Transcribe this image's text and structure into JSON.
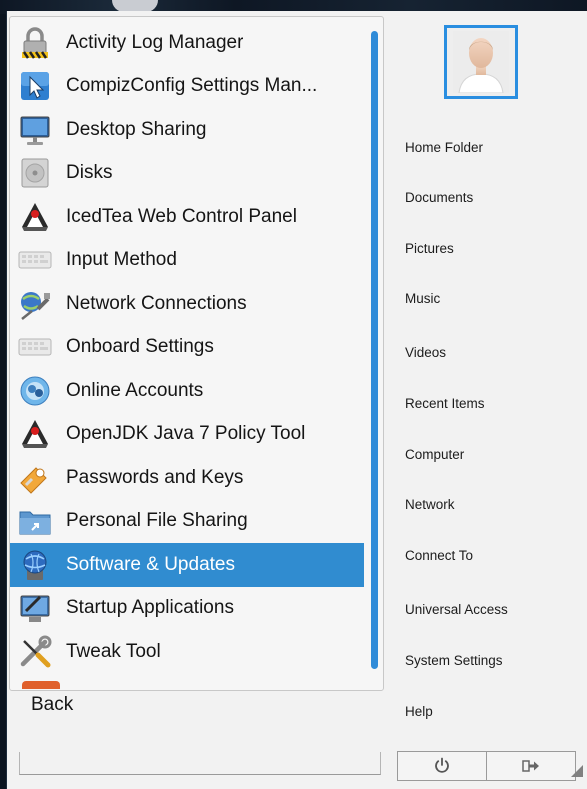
{
  "app_list": {
    "items": [
      {
        "label": "Activity Log Manager",
        "icon": "padlock-icon",
        "selected": false
      },
      {
        "label": "CompizConfig Settings Man...",
        "icon": "compiz-cursor-icon",
        "selected": false
      },
      {
        "label": "Desktop Sharing",
        "icon": "monitor-icon",
        "selected": false
      },
      {
        "label": "Disks",
        "icon": "disk-drive-icon",
        "selected": false
      },
      {
        "label": "IcedTea Web Control Panel",
        "icon": "java-duke-icon",
        "selected": false
      },
      {
        "label": "Input Method",
        "icon": "keyboard-icon",
        "selected": false
      },
      {
        "label": "Network Connections",
        "icon": "network-plug-icon",
        "selected": false
      },
      {
        "label": "Onboard Settings",
        "icon": "keyboard-icon",
        "selected": false
      },
      {
        "label": "Online Accounts",
        "icon": "online-accounts-icon",
        "selected": false
      },
      {
        "label": "OpenJDK Java 7 Policy Tool",
        "icon": "java-duke-icon",
        "selected": false
      },
      {
        "label": "Passwords and Keys",
        "icon": "keys-icon",
        "selected": false
      },
      {
        "label": "Personal File Sharing",
        "icon": "shared-folder-icon",
        "selected": false
      },
      {
        "label": "Software & Updates",
        "icon": "software-globe-icon",
        "selected": true
      },
      {
        "label": "Startup Applications",
        "icon": "startup-monitor-icon",
        "selected": false
      },
      {
        "label": "Tweak Tool",
        "icon": "wrench-screwdriver-icon",
        "selected": false
      }
    ],
    "back_label": "Back",
    "scroll_position": 0.0
  },
  "places": {
    "items": [
      "Home Folder",
      "Documents",
      "Pictures",
      "Music",
      "Videos",
      "Recent Items",
      "Computer",
      "Network",
      "Connect To",
      "Universal Access",
      "System Settings",
      "Help"
    ]
  },
  "user": {
    "avatar_icon": "user-avatar-icon"
  },
  "power": {
    "shutdown_icon": "power-icon",
    "logout_icon": "logout-icon"
  },
  "colors": {
    "selection": "#308cd0",
    "accent": "#2a8ee0",
    "menu_background": "#f2f2f2",
    "text": "#151515"
  }
}
